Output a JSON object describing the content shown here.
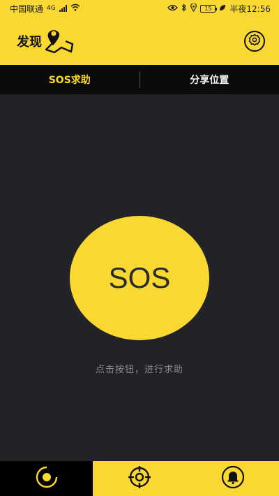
{
  "status_bar": {
    "carrier": "中国联通",
    "network": "4G",
    "battery": "15",
    "time_label": "半夜12:56"
  },
  "header": {
    "title": "发现",
    "logo_icon": "map-pin-icon",
    "settings_icon": "gear-icon"
  },
  "tabs": [
    {
      "label": "SOS求助",
      "active": true
    },
    {
      "label": "分享位置",
      "active": false
    }
  ],
  "main": {
    "sos_label": "SOS",
    "hint": "点击按钮，进行求助"
  },
  "bottom_nav": [
    {
      "icon": "radar-icon",
      "active": true
    },
    {
      "icon": "crosshair-icon",
      "active": false
    },
    {
      "icon": "bell-icon",
      "active": false
    }
  ],
  "colors": {
    "accent": "#FAD832",
    "background": "#222326",
    "tab_bar": "#0B0B0B",
    "hint_text": "#8A8A8A"
  }
}
